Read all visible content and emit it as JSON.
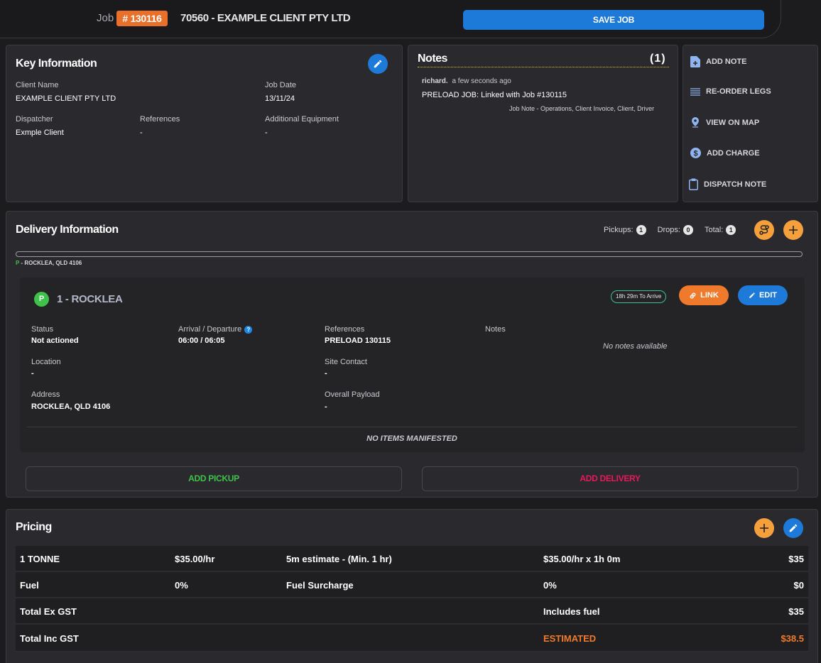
{
  "header": {
    "job_label": "Job",
    "job_number": "# 130116",
    "job_title": "70560 - EXAMPLE CLIENT PTY LTD",
    "save_label": "SAVE JOB"
  },
  "key_info": {
    "title": "Key Information",
    "client_name_label": "Client Name",
    "client_name": "EXAMPLE CLIENT PTY LTD",
    "job_date_label": "Job Date",
    "job_date": "13/11/24",
    "dispatcher_label": "Dispatcher",
    "dispatcher": "Exmple Client",
    "references_label": "References",
    "references": "-",
    "additional_equipment_label": "Additional Equipment",
    "additional_equipment": "-"
  },
  "notes": {
    "title": "Notes",
    "count": "(1)",
    "author": "richard.",
    "time": "a few seconds ago",
    "text": "PRELOAD JOB: Linked with Job #130115",
    "meta": "Job Note - Operations, Client Invoice, Client, Driver"
  },
  "actions": [
    {
      "label": "ADD NOTE",
      "icon": "note-add-icon"
    },
    {
      "label": "RE-ORDER LEGS",
      "icon": "reorder-icon"
    },
    {
      "label": "VIEW ON MAP",
      "icon": "map-pin-icon"
    },
    {
      "label": "ADD CHARGE",
      "icon": "dollar-icon"
    },
    {
      "label": "DISPATCH NOTE",
      "icon": "clipboard-icon"
    }
  ],
  "delivery": {
    "title": "Delivery Information",
    "pickups_label": "Pickups:",
    "pickups": "1",
    "drops_label": "Drops:",
    "drops": "0",
    "total_label": "Total:",
    "total": "1",
    "progress_p": "P",
    "progress_label": " - ROCKLEA, QLD 4106",
    "leg": {
      "badge": "P",
      "title": "1 - ROCKLEA",
      "eta": "18h 29m To Arrive",
      "link_label": "LINK",
      "edit_label": "EDIT",
      "status_label": "Status",
      "status": "Not actioned",
      "arrival_label": "Arrival / Departure",
      "arrival": "06:00 / 06:05",
      "references_label": "References",
      "references": "PRELOAD 130115",
      "notes_label": "Notes",
      "notes": "No notes available",
      "location_label": "Location",
      "location": "-",
      "site_contact_label": "Site Contact",
      "site_contact": "-",
      "address_label": "Address",
      "address": "ROCKLEA, QLD 4106",
      "payload_label": "Overall Payload",
      "payload": "-",
      "manifest": "NO ITEMS MANIFESTED"
    },
    "add_pickup": "ADD PICKUP",
    "add_delivery": "ADD DELIVERY"
  },
  "pricing": {
    "title": "Pricing",
    "rows": [
      {
        "c1": "1 TONNE",
        "c2": "$35.00/hr",
        "c3": "5m estimate - (Min. 1 hr)",
        "c4": "$35.00/hr x 1h 0m",
        "c5": "$35"
      },
      {
        "c1": "Fuel",
        "c2": "0%",
        "c3": "Fuel Surcharge",
        "c4": "0%",
        "c5": "$0"
      },
      {
        "c1": "Total Ex GST",
        "c2": "",
        "c3": "",
        "c4": "Includes fuel",
        "c5": "$35"
      },
      {
        "c1": "Total Inc GST",
        "c2": "",
        "c3": "",
        "c4": "ESTIMATED",
        "c5": "$38.5"
      }
    ]
  },
  "colors": {
    "accent_blue": "#1e7ad8",
    "accent_orange": "#e8702a",
    "pickup_green": "#3ec24a",
    "delivery_pink": "#e8185a"
  }
}
